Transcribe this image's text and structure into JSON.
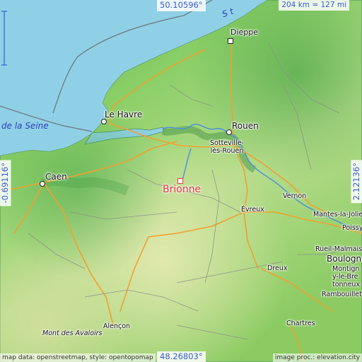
{
  "map": {
    "focus_place": "Brionne",
    "bounds": {
      "north": "50.10596°",
      "south": "48.26803°",
      "west": "-0.69116°",
      "east": "2.12136°"
    },
    "scale": "204 km = 127 mi",
    "water_labels": {
      "channel": "S t",
      "estuary": "de la Seine"
    },
    "places": [
      {
        "id": "dieppe",
        "name": "Dieppe"
      },
      {
        "id": "lehavre",
        "name": "Le Havre"
      },
      {
        "id": "rouen",
        "name": "Rouen"
      },
      {
        "id": "sotteville",
        "name": "Sotteville-lès-Rouen"
      },
      {
        "id": "caen",
        "name": "Caen"
      },
      {
        "id": "brionne",
        "name": "Brionne"
      },
      {
        "id": "vernon",
        "name": "Vernon"
      },
      {
        "id": "evreux",
        "name": "Évreux"
      },
      {
        "id": "mantes",
        "name": "Mantes-la-Jolie"
      },
      {
        "id": "poissy",
        "name": "Poissy"
      },
      {
        "id": "rueil",
        "name": "Rueil-Malmaison"
      },
      {
        "id": "boulogne",
        "name": "Boulogne"
      },
      {
        "id": "montigny",
        "name": "Montigny-le-Bretonneux"
      },
      {
        "id": "dreux",
        "name": "Dreux"
      },
      {
        "id": "rambouillet",
        "name": "Rambouillet"
      },
      {
        "id": "chartres",
        "name": "Chartres"
      },
      {
        "id": "alencon",
        "name": "Alençon"
      },
      {
        "id": "montavaloirs",
        "name": "Mont des Avaloirs"
      }
    ],
    "credits": {
      "left": "map data: openstreetmap, style: opentopomap",
      "right": "image proc.: elevation.city"
    },
    "colors": {
      "sea": "#8fd0e6",
      "land_low": "#7cc860",
      "land_mid": "#a6d67e",
      "land_high": "#d8e4a4",
      "roads": "#f0a030",
      "focus": "#e8323c",
      "coord_text": "#3a5bd0"
    }
  }
}
